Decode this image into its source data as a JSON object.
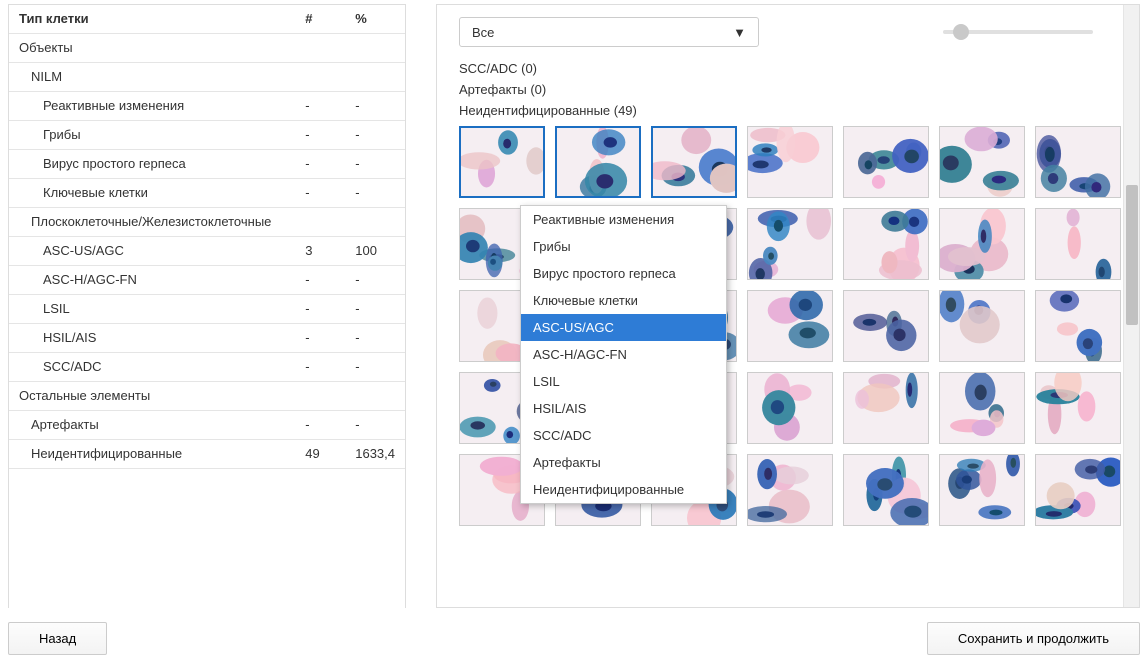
{
  "sidebar": {
    "header": {
      "type": "Тип клетки",
      "count": "#",
      "percent": "%"
    },
    "rows": [
      {
        "label": "Объекты",
        "indent": 0,
        "count": "",
        "percent": ""
      },
      {
        "label": "NILM",
        "indent": 1,
        "count": "",
        "percent": ""
      },
      {
        "label": "Реактивные изменения",
        "indent": 2,
        "count": "-",
        "percent": "-"
      },
      {
        "label": "Грибы",
        "indent": 2,
        "count": "-",
        "percent": "-"
      },
      {
        "label": "Вирус простого герпеса",
        "indent": 2,
        "count": "-",
        "percent": "-"
      },
      {
        "label": "Ключевые клетки",
        "indent": 2,
        "count": "-",
        "percent": "-"
      },
      {
        "label": "Плоскоклеточные/Железистоклеточные",
        "indent": 1,
        "count": "",
        "percent": ""
      },
      {
        "label": "ASC-US/AGC",
        "indent": 2,
        "count": "3",
        "percent": "100"
      },
      {
        "label": "ASC-H/AGC-FN",
        "indent": 2,
        "count": "-",
        "percent": "-"
      },
      {
        "label": "LSIL",
        "indent": 2,
        "count": "-",
        "percent": "-"
      },
      {
        "label": "HSIL/AIS",
        "indent": 2,
        "count": "-",
        "percent": "-"
      },
      {
        "label": "SCC/ADC",
        "indent": 2,
        "count": "-",
        "percent": "-"
      },
      {
        "label": "Остальные элементы",
        "indent": 0,
        "count": "",
        "percent": ""
      },
      {
        "label": "Артефакты",
        "indent": 1,
        "count": "-",
        "percent": "-"
      },
      {
        "label": "Неидентифицированные",
        "indent": 1,
        "count": "49",
        "percent": "1633,4"
      }
    ]
  },
  "filter": {
    "selected": "Все"
  },
  "categories": [
    {
      "label": "SCC/ADC (0)"
    },
    {
      "label": "Артефакты (0)"
    },
    {
      "label": "Неидентифицированные (49)"
    }
  ],
  "contextMenu": {
    "items": [
      "Реактивные изменения",
      "Грибы",
      "Вирус простого герпеса",
      "Ключевые клетки",
      "ASC-US/AGC",
      "ASC-H/AGC-FN",
      "LSIL",
      "HSIL/AIS",
      "SCC/ADC",
      "Артефакты",
      "Неидентифицированные"
    ],
    "selectedIndex": 4
  },
  "buttons": {
    "back": "Назад",
    "save": "Сохранить и продолжить"
  },
  "grid": {
    "rows": 5,
    "cols": 7,
    "selected": [
      0,
      1,
      2
    ]
  }
}
